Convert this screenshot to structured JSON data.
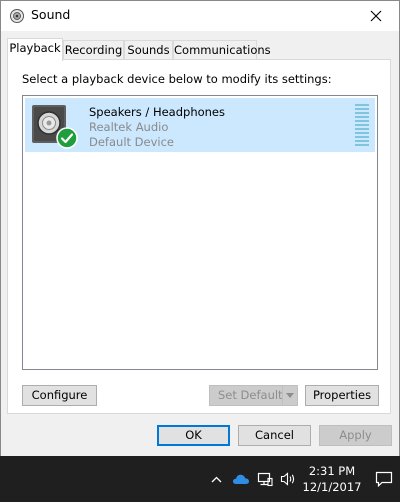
{
  "window": {
    "title": "Sound",
    "close_glyph": "✕"
  },
  "tabs": [
    {
      "label": "Playback",
      "active": true
    },
    {
      "label": "Recording",
      "active": false
    },
    {
      "label": "Sounds",
      "active": false
    },
    {
      "label": "Communications",
      "active": false
    }
  ],
  "playback": {
    "instruction": "Select a playback device below to modify its settings:",
    "devices": [
      {
        "name": "Speakers / Headphones",
        "driver": "Realtek Audio",
        "status": "Default Device",
        "icon": "speaker-icon",
        "badge": "default-check-icon",
        "level": 0
      }
    ],
    "buttons": {
      "configure": "Configure",
      "set_default": "Set Default",
      "properties": "Properties"
    }
  },
  "dialog_buttons": {
    "ok": "OK",
    "cancel": "Cancel",
    "apply": "Apply"
  },
  "taskbar": {
    "time": "2:31 PM",
    "date": "12/1/2017",
    "icons": [
      "chevron-up-icon",
      "onedrive-cloud-icon",
      "network-icon",
      "volume-icon",
      "action-center-icon"
    ]
  },
  "colors": {
    "selection": "#cce8ff",
    "accent": "#0078d7",
    "taskbar": "#1f1f1f",
    "check_green": "#1e9e3c"
  }
}
